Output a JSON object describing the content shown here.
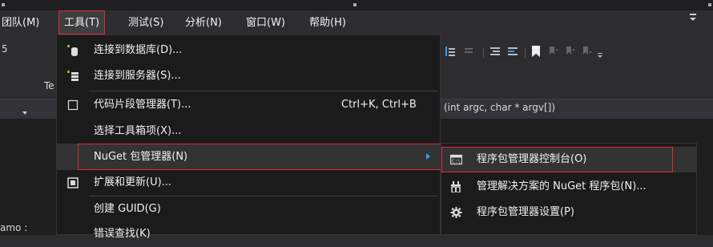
{
  "menubar": {
    "items": [
      {
        "label": "团队(M)"
      },
      {
        "label": "工具(T)"
      },
      {
        "label": "测试(S)"
      },
      {
        "label": "分析(N)"
      },
      {
        "label": "窗口(W)"
      },
      {
        "label": "帮助(H)"
      }
    ]
  },
  "left_fragments": {
    "toolbar_value": "5",
    "tab_label": "Te",
    "status_text": "amo :"
  },
  "file_bar": {
    "function_signature": "(int argc, char * argv[])"
  },
  "tools_menu": {
    "items": [
      {
        "label": "连接到数据库(D)...",
        "icon": "database-connect-icon"
      },
      {
        "label": "连接到服务器(S)...",
        "icon": "server-connect-icon"
      },
      {
        "label": "代码片段管理器(T)...",
        "shortcut": "Ctrl+K, Ctrl+B",
        "icon": "checkbox-icon"
      },
      {
        "label": "选择工具箱项(X)..."
      },
      {
        "label": "NuGet 包管理器(N)"
      },
      {
        "label": "扩展和更新(U)...",
        "icon": "extensions-icon"
      },
      {
        "label": "创建 GUID(G)"
      },
      {
        "label": "错误查找(K)"
      }
    ]
  },
  "nuget_submenu": {
    "items": [
      {
        "label": "程序包管理器控制台(O)",
        "icon": "console-icon"
      },
      {
        "label": "管理解决方案的 NuGet 程序包(N)...",
        "icon": "package-icon"
      },
      {
        "label": "程序包管理器设置(P)",
        "icon": "gear-icon"
      }
    ]
  },
  "colors": {
    "highlight_border": "#e0283a",
    "menu_background": "#1b1b1c",
    "arrow_accent": "#3399ff"
  }
}
